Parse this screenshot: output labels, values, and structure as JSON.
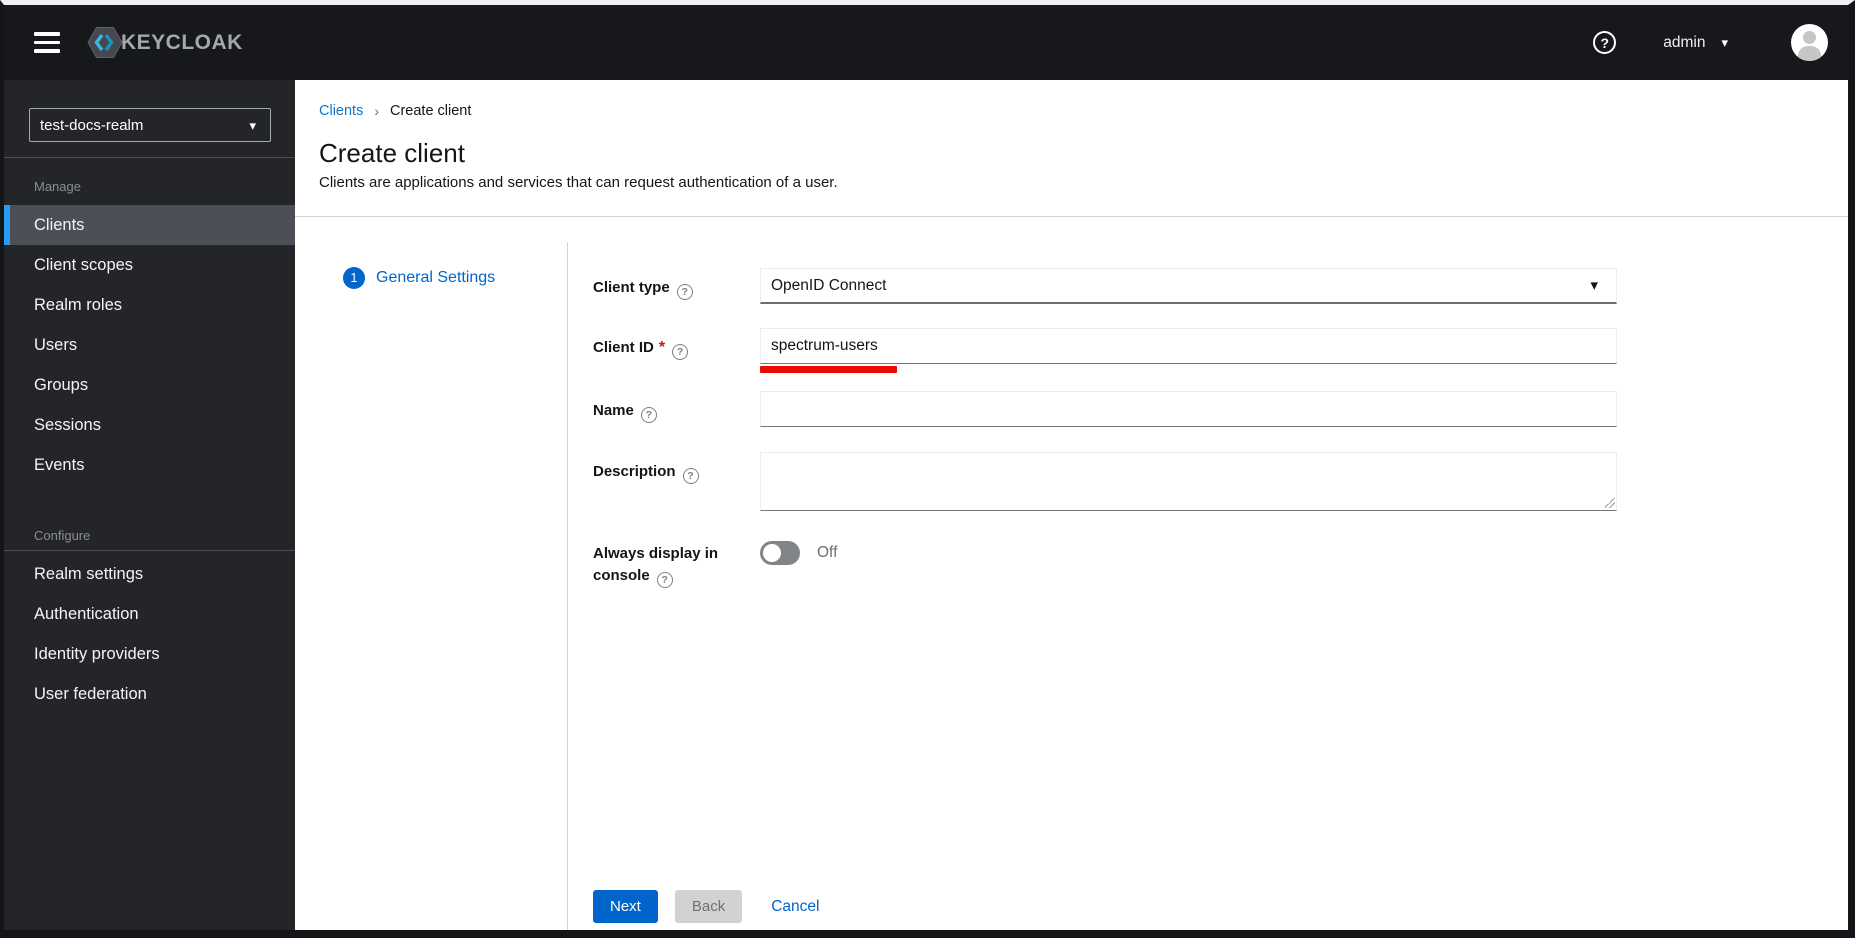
{
  "masthead": {
    "logo_text": "KEYCLOAK",
    "user_menu": {
      "label": "admin"
    }
  },
  "icons": {
    "help": "?",
    "caret_down": "▾",
    "breadcrumb_separator": "›"
  },
  "sidebar": {
    "realm_selector": {
      "value": "test-docs-realm"
    },
    "sections": [
      {
        "label": "Manage",
        "items": [
          {
            "label": "Clients",
            "active": true
          },
          {
            "label": "Client scopes"
          },
          {
            "label": "Realm roles"
          },
          {
            "label": "Users"
          },
          {
            "label": "Groups"
          },
          {
            "label": "Sessions"
          },
          {
            "label": "Events"
          }
        ]
      },
      {
        "label": "Configure",
        "items": [
          {
            "label": "Realm settings"
          },
          {
            "label": "Authentication"
          },
          {
            "label": "Identity providers"
          },
          {
            "label": "User federation"
          }
        ]
      }
    ]
  },
  "breadcrumb": {
    "link": "Clients",
    "current": "Create client"
  },
  "page": {
    "title": "Create client",
    "subtitle": "Clients are applications and services that can request authentication of a user."
  },
  "wizard": {
    "step": {
      "number": "1",
      "label": "General Settings"
    }
  },
  "form": {
    "fields": [
      {
        "label": "Client type",
        "type": "select",
        "value": "OpenID Connect"
      },
      {
        "label": "Client ID",
        "required": "*",
        "type": "text",
        "value": "spectrum-users",
        "annotation": "red-underline"
      },
      {
        "label": "Name",
        "type": "text",
        "value": ""
      },
      {
        "label": "Description",
        "type": "textarea",
        "value": ""
      },
      {
        "label": "Always display in console",
        "type": "switch",
        "state_label": "Off"
      }
    ]
  },
  "footer": {
    "next": "Next",
    "back": "Back",
    "cancel": "Cancel"
  },
  "colors": {
    "primary_blue": "#0066cc",
    "nav_active_accent": "#2b9af3",
    "annotation_red": "#ea0b00",
    "masthead_bg": "#17181c",
    "sidebar_bg": "#242529"
  }
}
